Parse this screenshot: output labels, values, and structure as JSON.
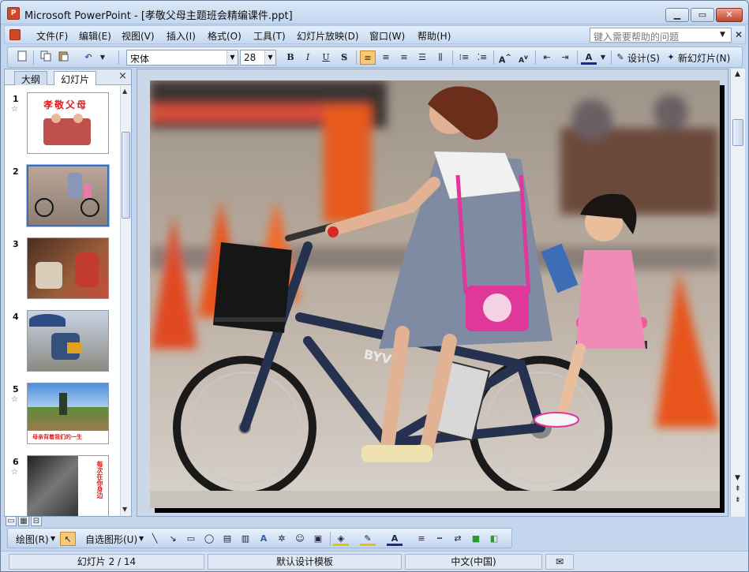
{
  "window": {
    "app_icon": "P",
    "title": "Microsoft PowerPoint - [孝敬父母主题班会精编课件.ppt]",
    "buttons": [
      "▁",
      "▭",
      "✕"
    ]
  },
  "menu": {
    "items": [
      "文件(F)",
      "编辑(E)",
      "视图(V)",
      "插入(I)",
      "格式(O)",
      "工具(T)",
      "幻灯片放映(D)",
      "窗口(W)",
      "帮助(H)"
    ],
    "help_placeholder": "键入需要帮助的问题",
    "help_dropdown": "▼",
    "close": "✕"
  },
  "toolbar": {
    "font": "宋体",
    "size": "28",
    "bold": "B",
    "italic": "I",
    "underline": "U",
    "shadow": "S",
    "design_label": "设计(S)",
    "new_slide_label": "新幻灯片(N)"
  },
  "pane": {
    "tabs": [
      "大纲",
      "幻灯片"
    ],
    "close": "×",
    "slides": [
      {
        "num": "1",
        "star": "☆",
        "desc": "title"
      },
      {
        "num": "2",
        "star": "",
        "desc": "bike"
      },
      {
        "num": "3",
        "star": "",
        "desc": "family"
      },
      {
        "num": "4",
        "star": "",
        "desc": "carry"
      },
      {
        "num": "5",
        "star": "☆",
        "desc": "field"
      },
      {
        "num": "6",
        "star": "☆",
        "desc": "bw"
      }
    ],
    "slide1_text": "孝敬父母",
    "slide5_caption": "母亲背着我们的一生",
    "slide6_text": "每次在你身边",
    "view_buttons": [
      "▭",
      "▦",
      "⊟"
    ]
  },
  "drawbar": {
    "draw_label": "绘图(R)",
    "autoshape_label": "自选图形(U)"
  },
  "status": {
    "slide_info": "幻灯片 2 / 14",
    "template": "默认设计模板",
    "language": "中文(中国)"
  },
  "colors": {
    "accent_orange": "#e85a1c",
    "selection_blue": "#3c6db5",
    "pink_bag": "#e0379b"
  }
}
